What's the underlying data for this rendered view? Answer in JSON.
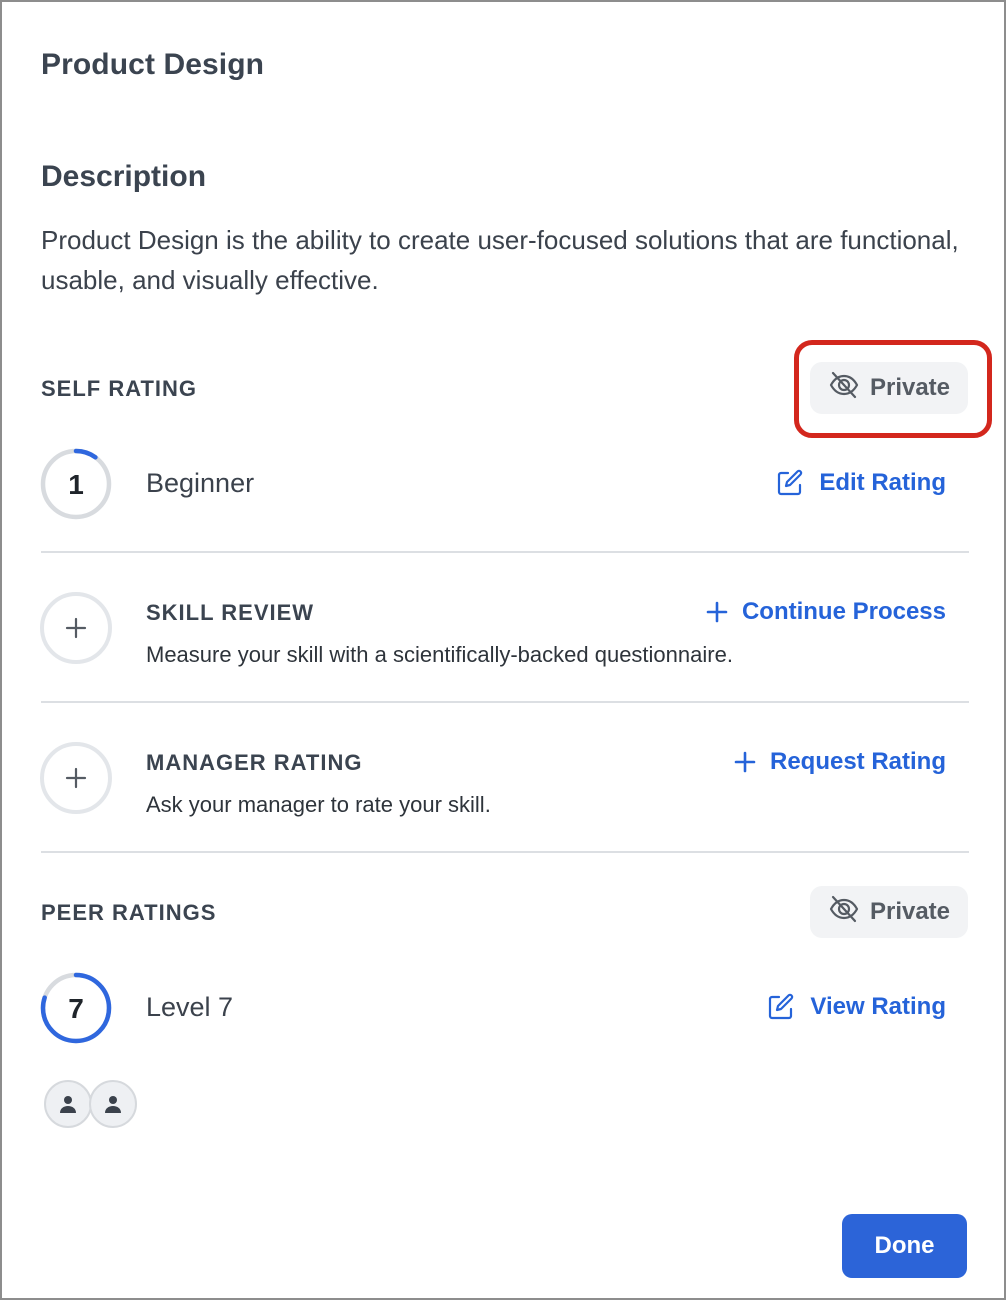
{
  "dialog": {
    "title": "Product Design",
    "description_heading": "Description",
    "description_text": "Product Design is the ability to create user-focused solutions that are functional, usable, and visually effective."
  },
  "self_rating": {
    "label": "SELF RATING",
    "visibility": "Private",
    "visibility_icon": "eye-off-icon",
    "level_number": "1",
    "level_name": "Beginner",
    "level_fraction": 0.1,
    "action": "Edit Rating",
    "action_icon": "pencil-square-icon"
  },
  "skill_review": {
    "title": "SKILL REVIEW",
    "subtitle": "Measure your skill with a scientifically-backed questionnaire.",
    "action": "Continue Process",
    "action_icon": "plus-icon"
  },
  "manager_rating": {
    "title": "MANAGER RATING",
    "subtitle": "Ask your manager to rate your skill.",
    "action": "Request Rating",
    "action_icon": "plus-icon"
  },
  "peer_ratings": {
    "label": "PEER RATINGS",
    "visibility": "Private",
    "visibility_icon": "eye-off-icon",
    "level_number": "7",
    "level_name": "Level 7",
    "level_fraction": 0.8,
    "action": "View Rating",
    "action_icon": "pencil-square-icon",
    "avatars": [
      "user-avatar",
      "user-avatar"
    ]
  },
  "footer": {
    "done_label": "Done"
  },
  "colors": {
    "accent": "#2c64d8",
    "link": "#2563d9",
    "highlight": "#d3271d",
    "text": "#3b4450",
    "pill_bg": "#f2f3f5"
  }
}
